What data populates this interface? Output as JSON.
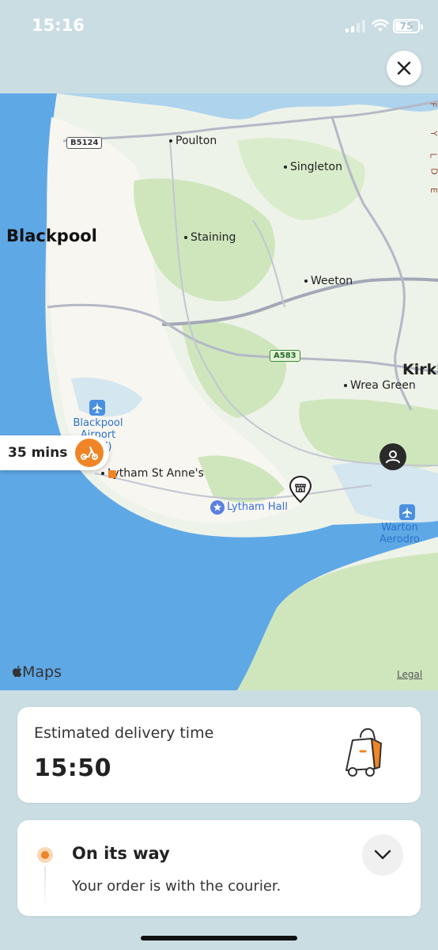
{
  "status_bar": {
    "time": "15:16",
    "battery": "75",
    "battery_level": 0.75
  },
  "map": {
    "city": "Blackpool",
    "places": {
      "poulton": "Poulton",
      "singleton": "Singleton",
      "staining": "Staining",
      "weeton": "Weeton",
      "wrea_green": "Wrea Green",
      "kirkham": "Kirkh",
      "lytham": "Lytham St Anne's"
    },
    "roads": {
      "b5124": "B5124",
      "a583": "A583"
    },
    "airports": {
      "blackpool": [
        "Blackpool",
        "Airport (BLK)"
      ],
      "warton": "Warton Aerodro"
    },
    "poi": {
      "lytham_hall": "Lytham Hall"
    },
    "edge_letters": [
      "F",
      "Y",
      "L",
      "D",
      "E"
    ],
    "brand": "Maps",
    "legal": "Legal",
    "eta_pill": "35 mins"
  },
  "colors": {
    "accent": "#ef8526",
    "water": "#5fa8e6",
    "land": "#eef3e9",
    "park": "#cfe6bd",
    "road": "#a3a8b8"
  },
  "delivery": {
    "label": "Estimated delivery time",
    "time": "15:50"
  },
  "order_status": {
    "title": "On its way",
    "subtitle": "Your order is with the courier."
  }
}
